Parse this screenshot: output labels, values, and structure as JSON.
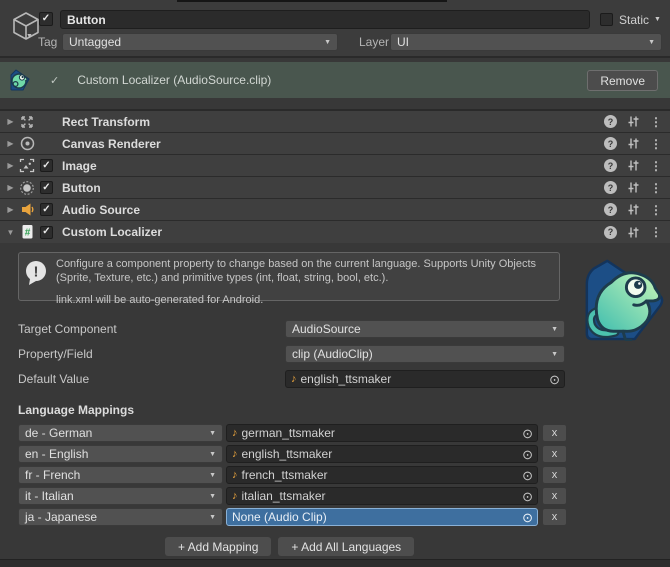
{
  "header": {
    "name_value": "Button",
    "static_label": "Static",
    "tag_label": "Tag",
    "tag_value": "Untagged",
    "layer_label": "Layer",
    "layer_value": "UI"
  },
  "banner": {
    "title": "Custom Localizer (AudioSource.clip)",
    "remove_label": "Remove"
  },
  "components": [
    {
      "label": "Rect Transform"
    },
    {
      "label": "Canvas Renderer"
    },
    {
      "label": "Image"
    },
    {
      "label": "Button"
    },
    {
      "label": "Audio Source"
    },
    {
      "label": "Custom Localizer"
    }
  ],
  "localizer": {
    "info_line1": "Configure a component property to change based on the current language. Supports Unity Objects (Sprite, Texture, etc.) and primitive types (int, float, string, bool, etc.).",
    "info_line2": "link.xml will be auto-generated for Android.",
    "target_component": {
      "label": "Target Component",
      "value": "AudioSource"
    },
    "property_field": {
      "label": "Property/Field",
      "value": "clip (AudioClip)"
    },
    "default_value": {
      "label": "Default Value",
      "value": "english_ttsmaker"
    },
    "mappings_title": "Language Mappings",
    "mappings": [
      {
        "language": "de - German",
        "clip": "german_ttsmaker"
      },
      {
        "language": "en - English",
        "clip": "english_ttsmaker"
      },
      {
        "language": "fr - French",
        "clip": "french_ttsmaker"
      },
      {
        "language": "it - Italian",
        "clip": "italian_ttsmaker"
      },
      {
        "language": "ja - Japanese",
        "clip": "None (Audio Clip)"
      }
    ],
    "remove_row_label": "x",
    "add_mapping_label": "+ Add Mapping",
    "add_all_label": "+ Add All Languages"
  },
  "icons": {
    "check": "✓",
    "dropdown_arrow": "▼",
    "foldout_collapsed": "▶",
    "foldout_expanded": "▼",
    "help": "?",
    "kebab": "⋮",
    "music_note": "♪",
    "picker": "⊙",
    "info_mark": "!"
  },
  "colors": {
    "banner_green": "#49564e",
    "selection_blue": "#3e6f9f",
    "audio_orange": "#e8a33d",
    "script_green": "#2e9e4f",
    "logo_blue": "#1c4e86"
  }
}
